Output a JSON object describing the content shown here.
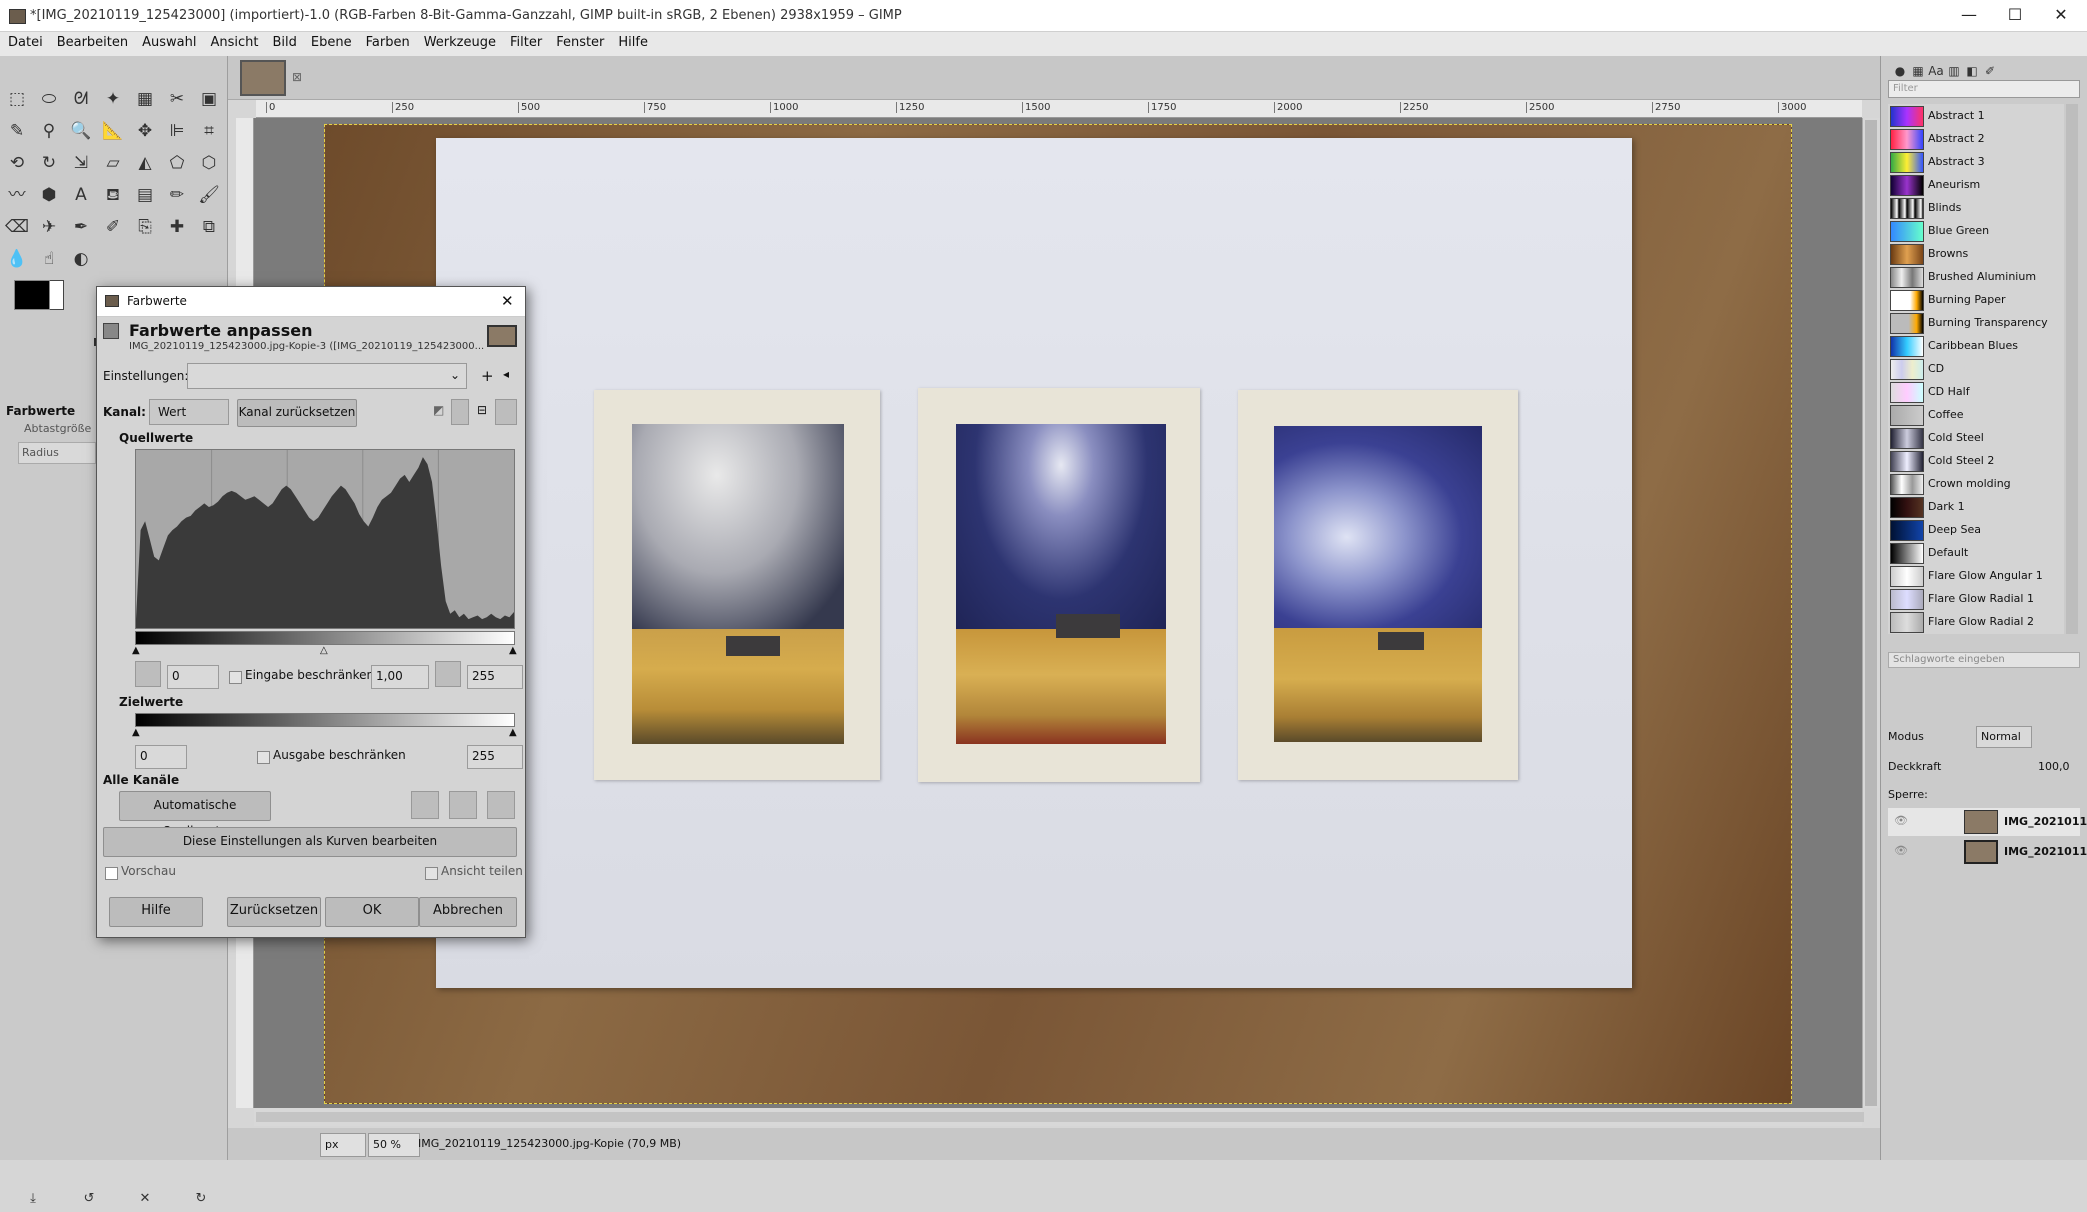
{
  "window": {
    "title": "*[IMG_20210119_125423000] (importiert)-1.0 (RGB-Farben 8-Bit-Gamma-Ganzzahl, GIMP built-in sRGB, 2 Ebenen) 2938x1959 – GIMP",
    "min_glyph": "—",
    "max_glyph": "☐",
    "close_glyph": "✕"
  },
  "menu": [
    "Datei",
    "Bearbeiten",
    "Auswahl",
    "Ansicht",
    "Bild",
    "Ebene",
    "Farben",
    "Werkzeuge",
    "Filter",
    "Fenster",
    "Hilfe"
  ],
  "toolbox": {
    "options_title": "Farbwerte",
    "sample_label": "Abtastgröße",
    "radius_label": "Radius"
  },
  "ruler": {
    "ticks": [
      "0",
      "250",
      "500",
      "750",
      "1000",
      "1250",
      "1500",
      "1750",
      "2000",
      "2250",
      "2500",
      "2750",
      "3000"
    ]
  },
  "statusbar": {
    "unit": "px",
    "zoom": "50 %",
    "info": "IMG_20210119_125423000.jpg-Kopie (70,9 MB)"
  },
  "gradients": {
    "filter_placeholder": "Filter",
    "tag_placeholder": "Schlagworte eingeben",
    "items": [
      {
        "name": "Abstract 1",
        "c": "linear-gradient(90deg,#2233cc,#aa33ff,#ff3366)"
      },
      {
        "name": "Abstract 2",
        "c": "linear-gradient(90deg,#ff2244,#ff99cc,#3344ff)"
      },
      {
        "name": "Abstract 3",
        "c": "linear-gradient(90deg,#33aa44,#ffee33,#3355ff)"
      },
      {
        "name": "Aneurism",
        "c": "linear-gradient(90deg,#110033,#9933cc,#000000)"
      },
      {
        "name": "Blinds",
        "c": "repeating-linear-gradient(90deg,#000 0,#fff 6px,#000 8px)"
      },
      {
        "name": "Blue Green",
        "c": "linear-gradient(90deg,#3388ff,#66ffcc)"
      },
      {
        "name": "Browns",
        "c": "linear-gradient(90deg,#6b3b12,#e0a050,#7a4518)"
      },
      {
        "name": "Brushed Aluminium",
        "c": "linear-gradient(90deg,#888,#eee,#777,#ddd)"
      },
      {
        "name": "Burning Paper",
        "c": "linear-gradient(90deg,#fff 60%,#ffaa00 80%,#000)"
      },
      {
        "name": "Burning Transparency",
        "c": "linear-gradient(90deg,#bbb 55%,#ffaa00 80%,#000)"
      },
      {
        "name": "Caribbean Blues",
        "c": "linear-gradient(90deg,#1133aa,#33ccff,#ffffff)"
      },
      {
        "name": "CD",
        "c": "linear-gradient(90deg,#eee,#cce,#eec,#cee)"
      },
      {
        "name": "CD Half",
        "c": "linear-gradient(90deg,#ddd,#fcf,#cff)"
      },
      {
        "name": "Coffee",
        "c": "linear-gradient(90deg,#aaa,#ccc)"
      },
      {
        "name": "Cold Steel",
        "c": "linear-gradient(90deg,#223,#ccd,#334)"
      },
      {
        "name": "Cold Steel 2",
        "c": "linear-gradient(90deg,#445,#eef,#223)"
      },
      {
        "name": "Crown molding",
        "c": "linear-gradient(90deg,#555,#fff,#999,#eee)"
      },
      {
        "name": "Dark 1",
        "c": "linear-gradient(90deg,#000,#331111,#553322)"
      },
      {
        "name": "Deep Sea",
        "c": "linear-gradient(90deg,#001133,#1144aa)"
      },
      {
        "name": "Default",
        "c": "linear-gradient(90deg,#000,#fff)"
      },
      {
        "name": "Flare Glow Angular 1",
        "c": "linear-gradient(90deg,#ccc,#fff,#ccc)"
      },
      {
        "name": "Flare Glow Radial 1",
        "c": "linear-gradient(90deg,#bbc,#ddf,#aab)"
      },
      {
        "name": "Flare Glow Radial 2",
        "c": "linear-gradient(90deg,#bbb,#ddd,#aaa)"
      }
    ]
  },
  "layers": {
    "mode_label": "Modus",
    "mode_value": "Normal",
    "opacity_label": "Deckkraft",
    "opacity_value": "100,0",
    "lock_label": "Sperre:",
    "items": [
      {
        "name": "IMG_2021011"
      },
      {
        "name": "IMG_2021011"
      }
    ]
  },
  "dialog": {
    "window_title": "Farbwerte",
    "heading": "Farbwerte anpassen",
    "subtitle": "IMG_20210119_125423000.jpg-Kopie-3 ([IMG_20210119_125423000...",
    "settings_label": "Einstellungen:",
    "channel_label": "Kanal:",
    "channel_value": "Wert",
    "reset_channel": "Kanal zurücksetzen",
    "input_levels": "Quellwerte",
    "output_levels": "Zielwerte",
    "input_low": "0",
    "gamma": "1,00",
    "input_high": "255",
    "clamp_input": "Eingabe beschränken",
    "output_low": "0",
    "output_high": "255",
    "clamp_output": "Ausgabe beschränken",
    "all_channels": "Alle Kanäle",
    "auto_button": "Automatische Quellwerte",
    "edit_curves": "Diese Einstellungen als Kurven bearbeiten",
    "preview": "Vorschau",
    "split_view": "Ansicht teilen",
    "help": "Hilfe",
    "reset": "Zurücksetzen",
    "ok": "OK",
    "cancel": "Abbrechen",
    "close_glyph": "✕",
    "histogram": [
      0.05,
      0.55,
      0.6,
      0.5,
      0.4,
      0.38,
      0.45,
      0.52,
      0.55,
      0.57,
      0.6,
      0.62,
      0.63,
      0.66,
      0.68,
      0.7,
      0.68,
      0.69,
      0.71,
      0.74,
      0.76,
      0.77,
      0.76,
      0.74,
      0.72,
      0.73,
      0.74,
      0.72,
      0.7,
      0.68,
      0.7,
      0.74,
      0.78,
      0.8,
      0.78,
      0.74,
      0.7,
      0.66,
      0.62,
      0.6,
      0.62,
      0.66,
      0.7,
      0.74,
      0.77,
      0.8,
      0.78,
      0.74,
      0.7,
      0.64,
      0.6,
      0.57,
      0.62,
      0.68,
      0.72,
      0.74,
      0.76,
      0.8,
      0.84,
      0.86,
      0.82,
      0.86,
      0.9,
      0.96,
      0.92,
      0.82,
      0.6,
      0.35,
      0.15,
      0.08,
      0.1,
      0.06,
      0.08,
      0.05,
      0.06,
      0.07,
      0.05,
      0.06,
      0.08,
      0.06,
      0.05,
      0.07,
      0.06,
      0.09
    ]
  }
}
